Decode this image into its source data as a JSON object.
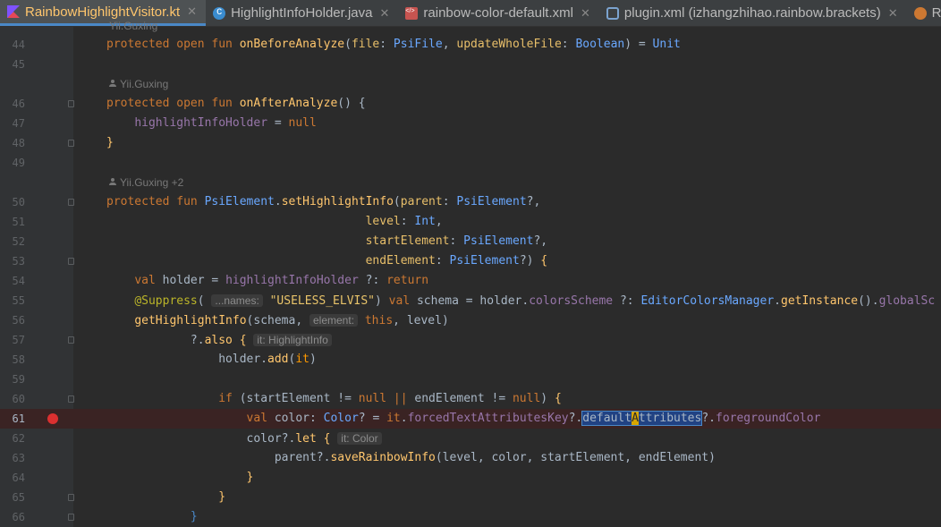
{
  "tabs": [
    {
      "label": "RainbowHighlightVisitor.kt",
      "icon": "kotlin-file-icon",
      "active": true
    },
    {
      "label": "HighlightInfoHolder.java",
      "icon": "java-class-icon",
      "active": false
    },
    {
      "label": "rainbow-color-default.xml",
      "icon": "xml-file-icon",
      "active": false
    },
    {
      "label": "plugin.xml (izhangzhihao.rainbow.brackets)",
      "icon": "plugin-xml-icon",
      "active": false
    },
    {
      "label": "Rai",
      "icon": "file-icon",
      "active": false
    }
  ],
  "top_author": "Yii.Guxing",
  "lines": {
    "l44": {
      "num": "44"
    },
    "l45": {
      "num": "45"
    },
    "a1": {
      "author": "Yii.Guxing"
    },
    "l46": {
      "num": "46"
    },
    "l47": {
      "num": "47"
    },
    "l48": {
      "num": "48"
    },
    "l49": {
      "num": "49"
    },
    "a2": {
      "author": "Yii.Guxing +2"
    },
    "l50": {
      "num": "50"
    },
    "l51": {
      "num": "51"
    },
    "l52": {
      "num": "52"
    },
    "l53": {
      "num": "53"
    },
    "l54": {
      "num": "54"
    },
    "l55": {
      "num": "55"
    },
    "l56": {
      "num": "56"
    },
    "l57": {
      "num": "57"
    },
    "l58": {
      "num": "58"
    },
    "l59": {
      "num": "59"
    },
    "l60": {
      "num": "60"
    },
    "l61": {
      "num": "61"
    },
    "l62": {
      "num": "62"
    },
    "l63": {
      "num": "63"
    },
    "l64": {
      "num": "64"
    },
    "l65": {
      "num": "65"
    },
    "l66": {
      "num": "66"
    }
  },
  "hints": {
    "names": "...names:",
    "element": "element:",
    "it_highlightinfo": "it: HighlightInfo",
    "it_color": "it: Color"
  },
  "colors": {
    "background": "#2b2b2b",
    "gutter": "#313335",
    "keyword": "#cc7832",
    "function": "#ffc66d",
    "breakpoint": "#db3030"
  }
}
